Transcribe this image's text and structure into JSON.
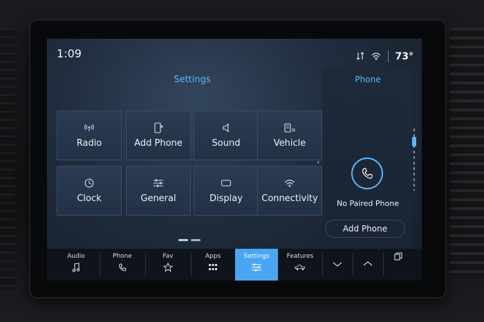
{
  "status": {
    "time": "1:09",
    "temperature": "73°"
  },
  "settings": {
    "title": "Settings",
    "tiles": [
      {
        "label": "Radio",
        "icon": "radio-icon"
      },
      {
        "label": "Add Phone",
        "icon": "add-phone-icon"
      },
      {
        "label": "Sound",
        "icon": "speaker-icon"
      },
      {
        "label": "Vehicle",
        "icon": "vehicle-icon"
      },
      {
        "label": "Clock",
        "icon": "clock-icon"
      },
      {
        "label": "General",
        "icon": "sliders-icon"
      },
      {
        "label": "Display",
        "icon": "display-icon"
      },
      {
        "label": "Connectivity",
        "icon": "wifi-icon"
      }
    ]
  },
  "phone_panel": {
    "title": "Phone",
    "status": "No Paired Phone",
    "button": "Add Phone"
  },
  "bottom_nav": [
    {
      "label": "Audio",
      "icon": "music-note-icon"
    },
    {
      "label": "Phone",
      "icon": "phone-icon"
    },
    {
      "label": "Fav",
      "icon": "star-icon"
    },
    {
      "label": "Apps",
      "icon": "apps-grid-icon"
    },
    {
      "label": "Settings",
      "icon": "settings-sliders-icon",
      "active": true
    },
    {
      "label": "Features",
      "icon": "truck-icon"
    }
  ],
  "colors": {
    "accent": "#5cb8ff",
    "active_tab": "#4aa6f2",
    "tile": "#2a3b52"
  }
}
